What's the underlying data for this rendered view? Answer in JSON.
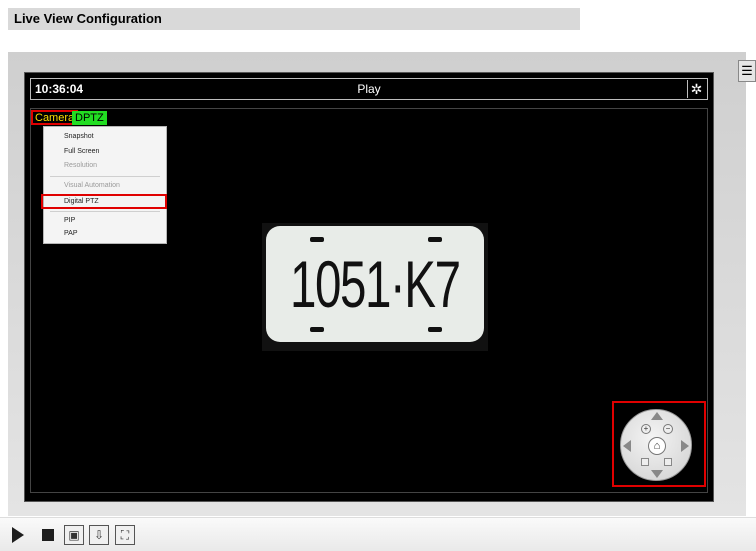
{
  "header": {
    "title": "Live View Configuration"
  },
  "player": {
    "time": "10:36:04",
    "title": "Play",
    "settings_icon": "gear-icon",
    "tags": {
      "camera": "Camera",
      "dptz": "DPTZ"
    }
  },
  "context_menu": {
    "items": [
      {
        "label": "Snapshot",
        "enabled": true
      },
      {
        "label": "Full Screen",
        "enabled": true
      },
      {
        "label": "Resolution",
        "enabled": false
      },
      {
        "label": "Visual Automation",
        "enabled": false
      },
      {
        "label": "Digital PTZ",
        "enabled": true,
        "highlighted": true
      },
      {
        "label": "PIP",
        "enabled": true
      },
      {
        "label": "PAP",
        "enabled": true
      }
    ]
  },
  "video": {
    "plate_text": "1051·K7"
  },
  "ptz": {
    "home_icon": "home-icon",
    "zoom_in_label": "+",
    "zoom_out_label": "−"
  },
  "colors": {
    "highlight": "#e00000",
    "camera_tag": "#ffde00",
    "dptz_tag": "#22dd22"
  },
  "controls": {
    "icons": [
      "play-icon",
      "stop-icon",
      "snapshot-icon",
      "record-icon",
      "fullscreen-icon"
    ]
  }
}
